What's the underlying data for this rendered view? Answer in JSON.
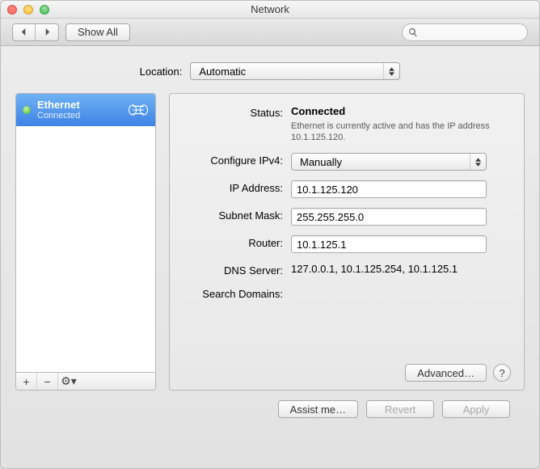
{
  "window": {
    "title": "Network"
  },
  "toolbar": {
    "show_all": "Show All",
    "search_placeholder": ""
  },
  "location": {
    "label": "Location:",
    "value": "Automatic"
  },
  "sidebar": {
    "services": [
      {
        "name": "Ethernet",
        "status": "Connected",
        "selected": true,
        "dot": "#4bbf2a"
      }
    ],
    "tools": {
      "add": "+",
      "remove": "−",
      "action": "⚙︎▾"
    }
  },
  "main": {
    "status_label": "Status:",
    "status_value": "Connected",
    "status_detail": "Ethernet is currently active and has the IP address 10.1.125.120.",
    "configure_label": "Configure IPv4:",
    "configure_value": "Manually",
    "ip_label": "IP Address:",
    "ip_value": "10.1.125.120",
    "subnet_label": "Subnet Mask:",
    "subnet_value": "255.255.255.0",
    "router_label": "Router:",
    "router_value": "10.1.125.1",
    "dns_label": "DNS Server:",
    "dns_value": "127.0.0.1, 10.1.125.254, 10.1.125.1",
    "search_domains_label": "Search Domains:",
    "search_domains_value": "",
    "advanced": "Advanced…",
    "help": "?"
  },
  "footer": {
    "assist": "Assist me…",
    "revert": "Revert",
    "apply": "Apply"
  }
}
